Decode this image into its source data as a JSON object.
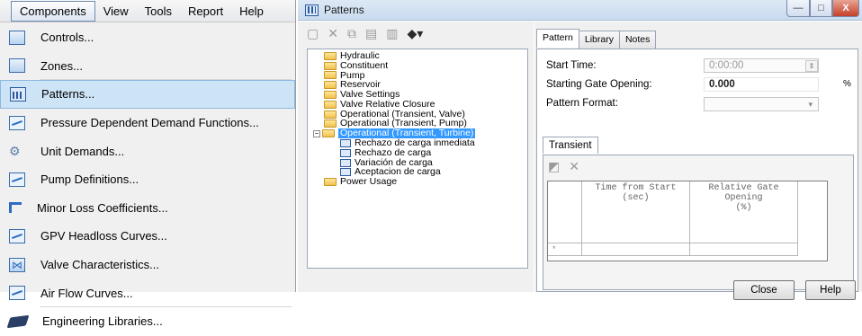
{
  "menubar": {
    "items": [
      "Components",
      "View",
      "Tools",
      "Report",
      "Help"
    ]
  },
  "menu": {
    "items": [
      {
        "label": "Controls...",
        "icon": "controls-icon"
      },
      {
        "label": "Zones...",
        "icon": "zones-icon"
      },
      {
        "label": "Patterns...",
        "icon": "patterns-icon",
        "selected": true
      },
      {
        "label": "Pressure Dependent Demand Functions...",
        "icon": "pressure-demand-icon"
      },
      {
        "label": "Unit Demands...",
        "icon": "unit-demands-icon"
      },
      {
        "label": "Pump Definitions...",
        "icon": "pump-definitions-icon"
      },
      {
        "label": "Minor Loss Coefficients...",
        "icon": "minor-loss-icon"
      },
      {
        "label": "GPV Headloss Curves...",
        "icon": "gpv-curve-icon"
      },
      {
        "label": "Valve Characteristics...",
        "icon": "valve-characteristics-icon"
      },
      {
        "label": "Air Flow Curves...",
        "icon": "air-flow-curve-icon"
      },
      {
        "label": "Engineering Libraries...",
        "icon": "engineering-libraries-icon"
      }
    ]
  },
  "window": {
    "title": "Patterns",
    "min_label": "—",
    "max_label": "□",
    "close_label": "X"
  },
  "tree": {
    "items": [
      {
        "label": "Hydraulic",
        "type": "folder",
        "level": 0
      },
      {
        "label": "Constituent",
        "type": "folder",
        "level": 0
      },
      {
        "label": "Pump",
        "type": "folder",
        "level": 0
      },
      {
        "label": "Reservoir",
        "type": "folder",
        "level": 0
      },
      {
        "label": "Valve Settings",
        "type": "folder",
        "level": 0
      },
      {
        "label": "Valve Relative Closure",
        "type": "folder",
        "level": 0
      },
      {
        "label": "Operational (Transient, Valve)",
        "type": "folder",
        "level": 0
      },
      {
        "label": "Operational (Transient, Pump)",
        "type": "folder",
        "level": 0
      },
      {
        "label": "Operational (Transient, Turbine)",
        "type": "folder",
        "level": 0,
        "selected": true,
        "expanded": true
      },
      {
        "label": "Rechazo de carga inmediata",
        "type": "pattern",
        "level": 1
      },
      {
        "label": "Rechazo de carga",
        "type": "pattern",
        "level": 1
      },
      {
        "label": "Variación de carga",
        "type": "pattern",
        "level": 1
      },
      {
        "label": "Aceptacion de carga",
        "type": "pattern",
        "level": 1
      },
      {
        "label": "Power Usage",
        "type": "folder",
        "level": 0
      }
    ]
  },
  "tabs": [
    "Pattern",
    "Library",
    "Notes"
  ],
  "form": {
    "start_time_label": "Start Time:",
    "start_time_value": "0:00:00",
    "gate_label": "Starting Gate Opening:",
    "gate_value": "0.000",
    "gate_unit": "%",
    "format_label": "Pattern Format:",
    "format_value": ""
  },
  "transient": {
    "tab_label": "Transient",
    "columns": [
      "Time from Start\n(sec)",
      "Relative Gate\nOpening\n(%)"
    ],
    "new_row_marker": "*"
  },
  "buttons": {
    "close": "Close",
    "help": "Help"
  },
  "colors": {
    "selection": "#3399ff",
    "menu_highlight": "#cde4f7"
  }
}
